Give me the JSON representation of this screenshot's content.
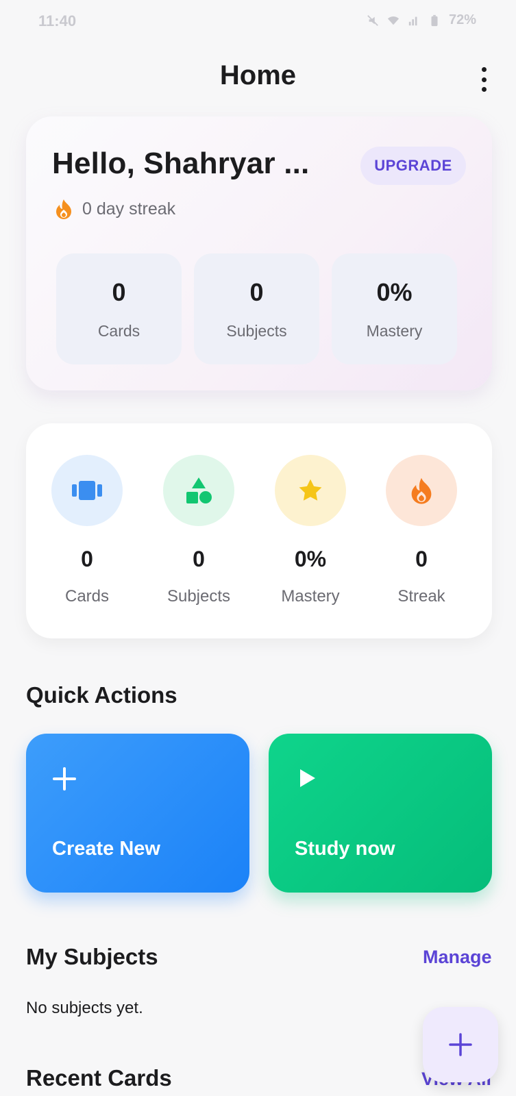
{
  "status_bar": {
    "time": "11:40",
    "battery": "72%"
  },
  "header": {
    "title": "Home",
    "menu_icon": "more-vertical-icon"
  },
  "hero": {
    "greeting": "Hello, Shahryar ...",
    "upgrade_label": "UPGRADE",
    "streak_text": "0 day streak",
    "stats": [
      {
        "value": "0",
        "label": "Cards"
      },
      {
        "value": "0",
        "label": "Subjects"
      },
      {
        "value": "0%",
        "label": "Mastery"
      }
    ]
  },
  "stats": [
    {
      "value": "0",
      "label": "Cards",
      "icon": "cards-icon",
      "bg": "#e3effd",
      "color": "#3b8ef0"
    },
    {
      "value": "0",
      "label": "Subjects",
      "icon": "shapes-icon",
      "bg": "#e0f7ea",
      "color": "#12c671"
    },
    {
      "value": "0%",
      "label": "Mastery",
      "icon": "star-icon",
      "bg": "#fdf2cf",
      "color": "#f5c518"
    },
    {
      "value": "0",
      "label": "Streak",
      "icon": "flame-icon",
      "bg": "#fde6d8",
      "color": "#f57c1f"
    }
  ],
  "quick_actions": {
    "title": "Quick Actions",
    "create_label": "Create New",
    "study_label": "Study now"
  },
  "subjects": {
    "title": "My Subjects",
    "manage_label": "Manage",
    "empty_text": "No subjects yet."
  },
  "recent": {
    "title": "Recent Cards",
    "view_all_label": "View All"
  },
  "colors": {
    "accent": "#5b44d6",
    "blue": "#1b82f8",
    "green": "#05bd7a"
  }
}
